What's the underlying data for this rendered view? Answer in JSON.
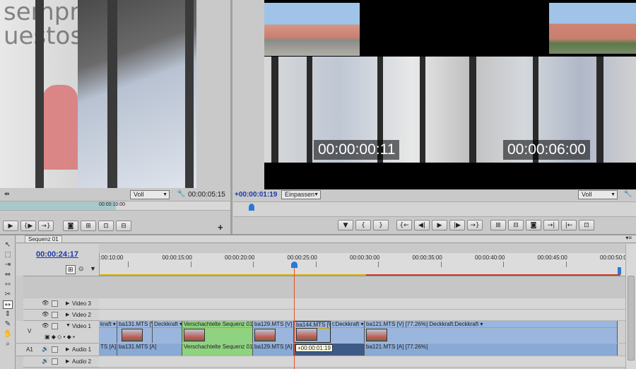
{
  "source_monitor": {
    "zoom_select": "Voll",
    "timecode": "00:00:05:15",
    "ruler_tc": "00:00:10:00"
  },
  "program_monitor": {
    "overlay_tc_left": "00:00:00:11",
    "overlay_tc_right": "00:00:06:00",
    "current_tc": "+00:00:01:19",
    "fit_select": "Einpassen",
    "zoom_select": "Voll"
  },
  "timeline": {
    "tab_label": "Sequenz 01",
    "current_tc": "00:00:24:17",
    "ruler_labels": [
      ":00:10:00",
      "00:00:15:00",
      "00:00:20:00",
      "00:00:25:00",
      "00:00:30:00",
      "00:00:35:00",
      "00:00:40:00",
      "00:00:45:00",
      "00:00:50:0"
    ],
    "tracks": {
      "video3": "Video 3",
      "video2": "Video 2",
      "video1": "Video 1",
      "video1_tag": "V",
      "audio1": "Audio 1",
      "audio1_tag": "A1",
      "audio2": "Audio 2"
    },
    "video_clips": [
      "kraft",
      "ba131.MTS [V]",
      "Deckkraft",
      "Verschachtelte Sequenz 01 [V]",
      "ba129.MTS [V]",
      "ba144.MTS [V]",
      "t:Deckkraft",
      "ba121.MTS [V] [77.26%] Deckkraft:Deckkraft"
    ],
    "audio_clips": [
      "TS [A]",
      "ba131.MTS [A]",
      "Verschachtelte Sequenz 01 [A]",
      "ba129.MTS [A]",
      "ba121.MTS [A] [77.26%]"
    ],
    "drag_tooltip": "+00:00:01:19"
  },
  "icons": [
    "play-icon",
    "step-forward-icon",
    "camera-icon",
    "zoom-icon",
    "wrench-icon",
    "add-icon",
    "marker-icon",
    "in-point-icon",
    "out-point-icon",
    "eye-icon",
    "speaker-icon"
  ],
  "colors": {
    "playhead": "#e0502a",
    "nested_clip": "#8ed37f",
    "video_clip": "#9ab6de",
    "workarea_red": "#c83a2a",
    "workarea_yellow": "#d6b000"
  }
}
